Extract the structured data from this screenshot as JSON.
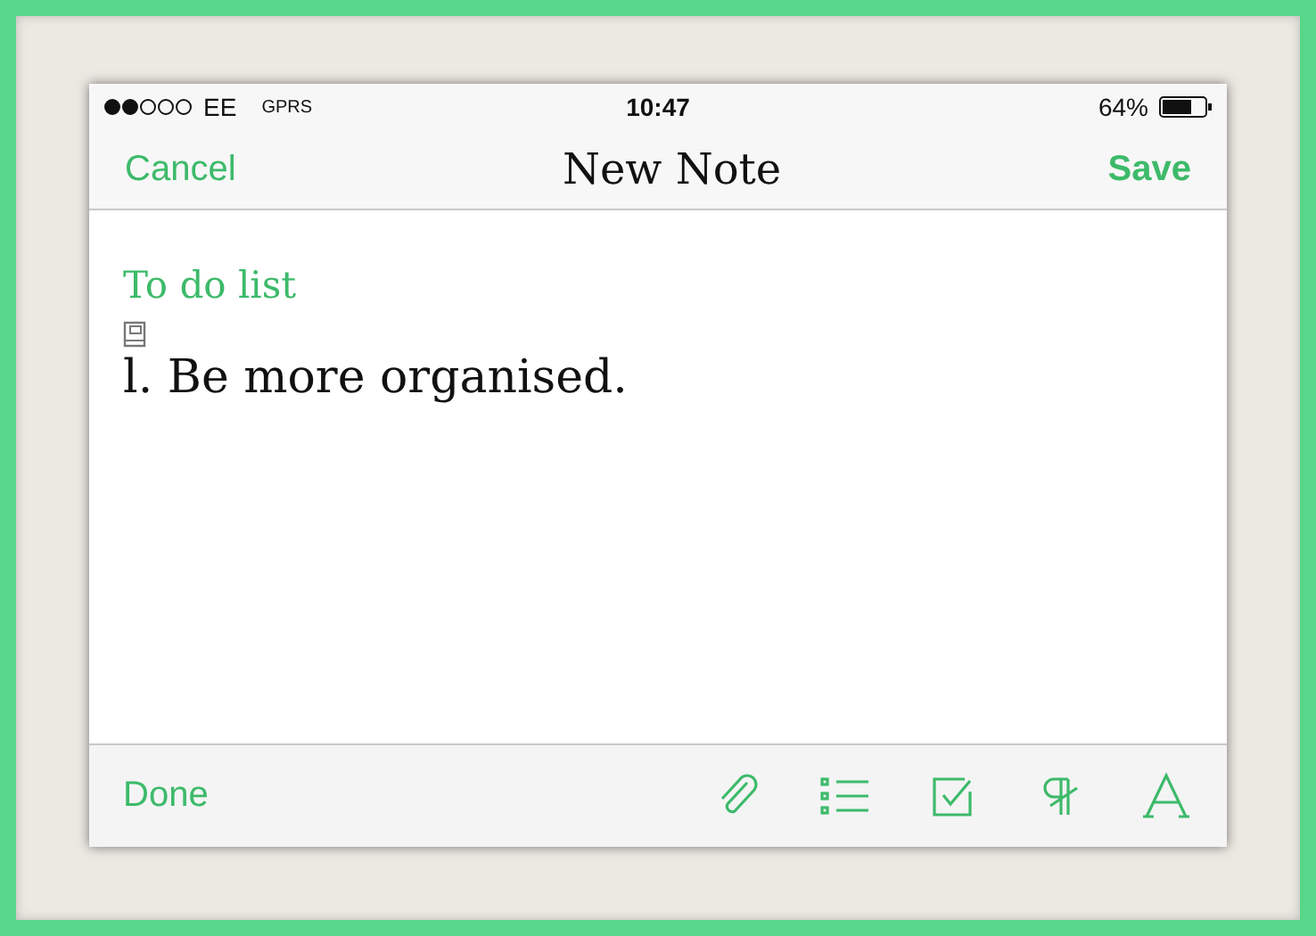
{
  "status_bar": {
    "carrier": "EE",
    "network": "GPRS",
    "time": "10:47",
    "battery": "64%"
  },
  "nav": {
    "cancel": "Cancel",
    "title": "New Note",
    "save": "Save"
  },
  "note": {
    "title": "To do list",
    "body": "l. Be more organised."
  },
  "toolbar": {
    "done": "Done"
  }
}
